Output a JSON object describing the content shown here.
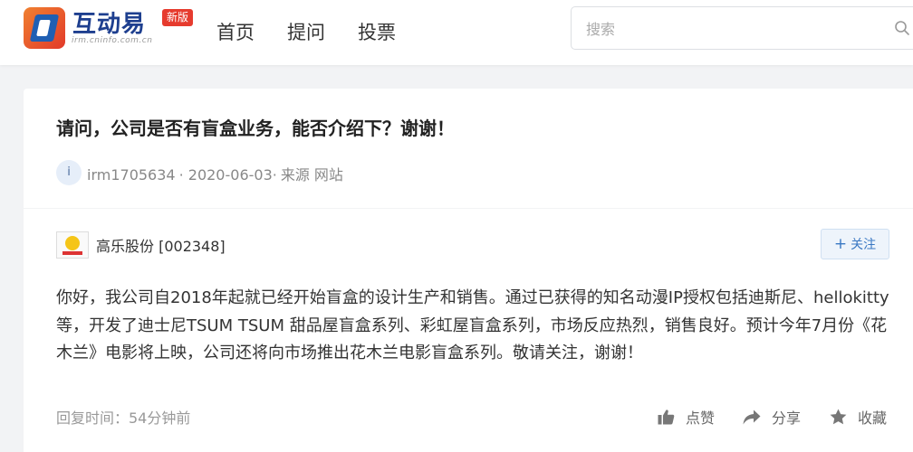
{
  "header": {
    "logo_text": "互动易",
    "logo_sub": "irm.cninfo.com.cn",
    "badge": "新版",
    "nav": [
      "首页",
      "提问",
      "投票"
    ],
    "search_placeholder": "搜索"
  },
  "question": {
    "title": "请问，公司是否有盲盒业务，能否介绍下？谢谢！",
    "avatar_letter": "i",
    "user": "irm1705634",
    "date": "· 2020-06-03·",
    "source": "来源 网站"
  },
  "answer": {
    "company": "高乐股份 [002348]",
    "follow_label": "关注",
    "body": "你好，我公司自2018年起就已经开始盲盒的设计生产和销售。通过已获得的知名动漫IP授权包括迪斯尼、hellokitty 等，开发了迪士尼TSUM TSUM 甜品屋盲盒系列、彩虹屋盲盒系列，市场反应热烈，销售良好。预计今年7月份《花木兰》电影将上映，公司还将向市场推出花木兰电影盲盒系列。敬请关注，谢谢！",
    "reply_time": "回复时间：54分钟前",
    "actions": {
      "like": "点赞",
      "share": "分享",
      "collect": "收藏"
    }
  },
  "colors": {
    "brand_blue": "#1e3f8f",
    "badge_red": "#e63b2e",
    "follow_blue": "#3a78c3"
  }
}
